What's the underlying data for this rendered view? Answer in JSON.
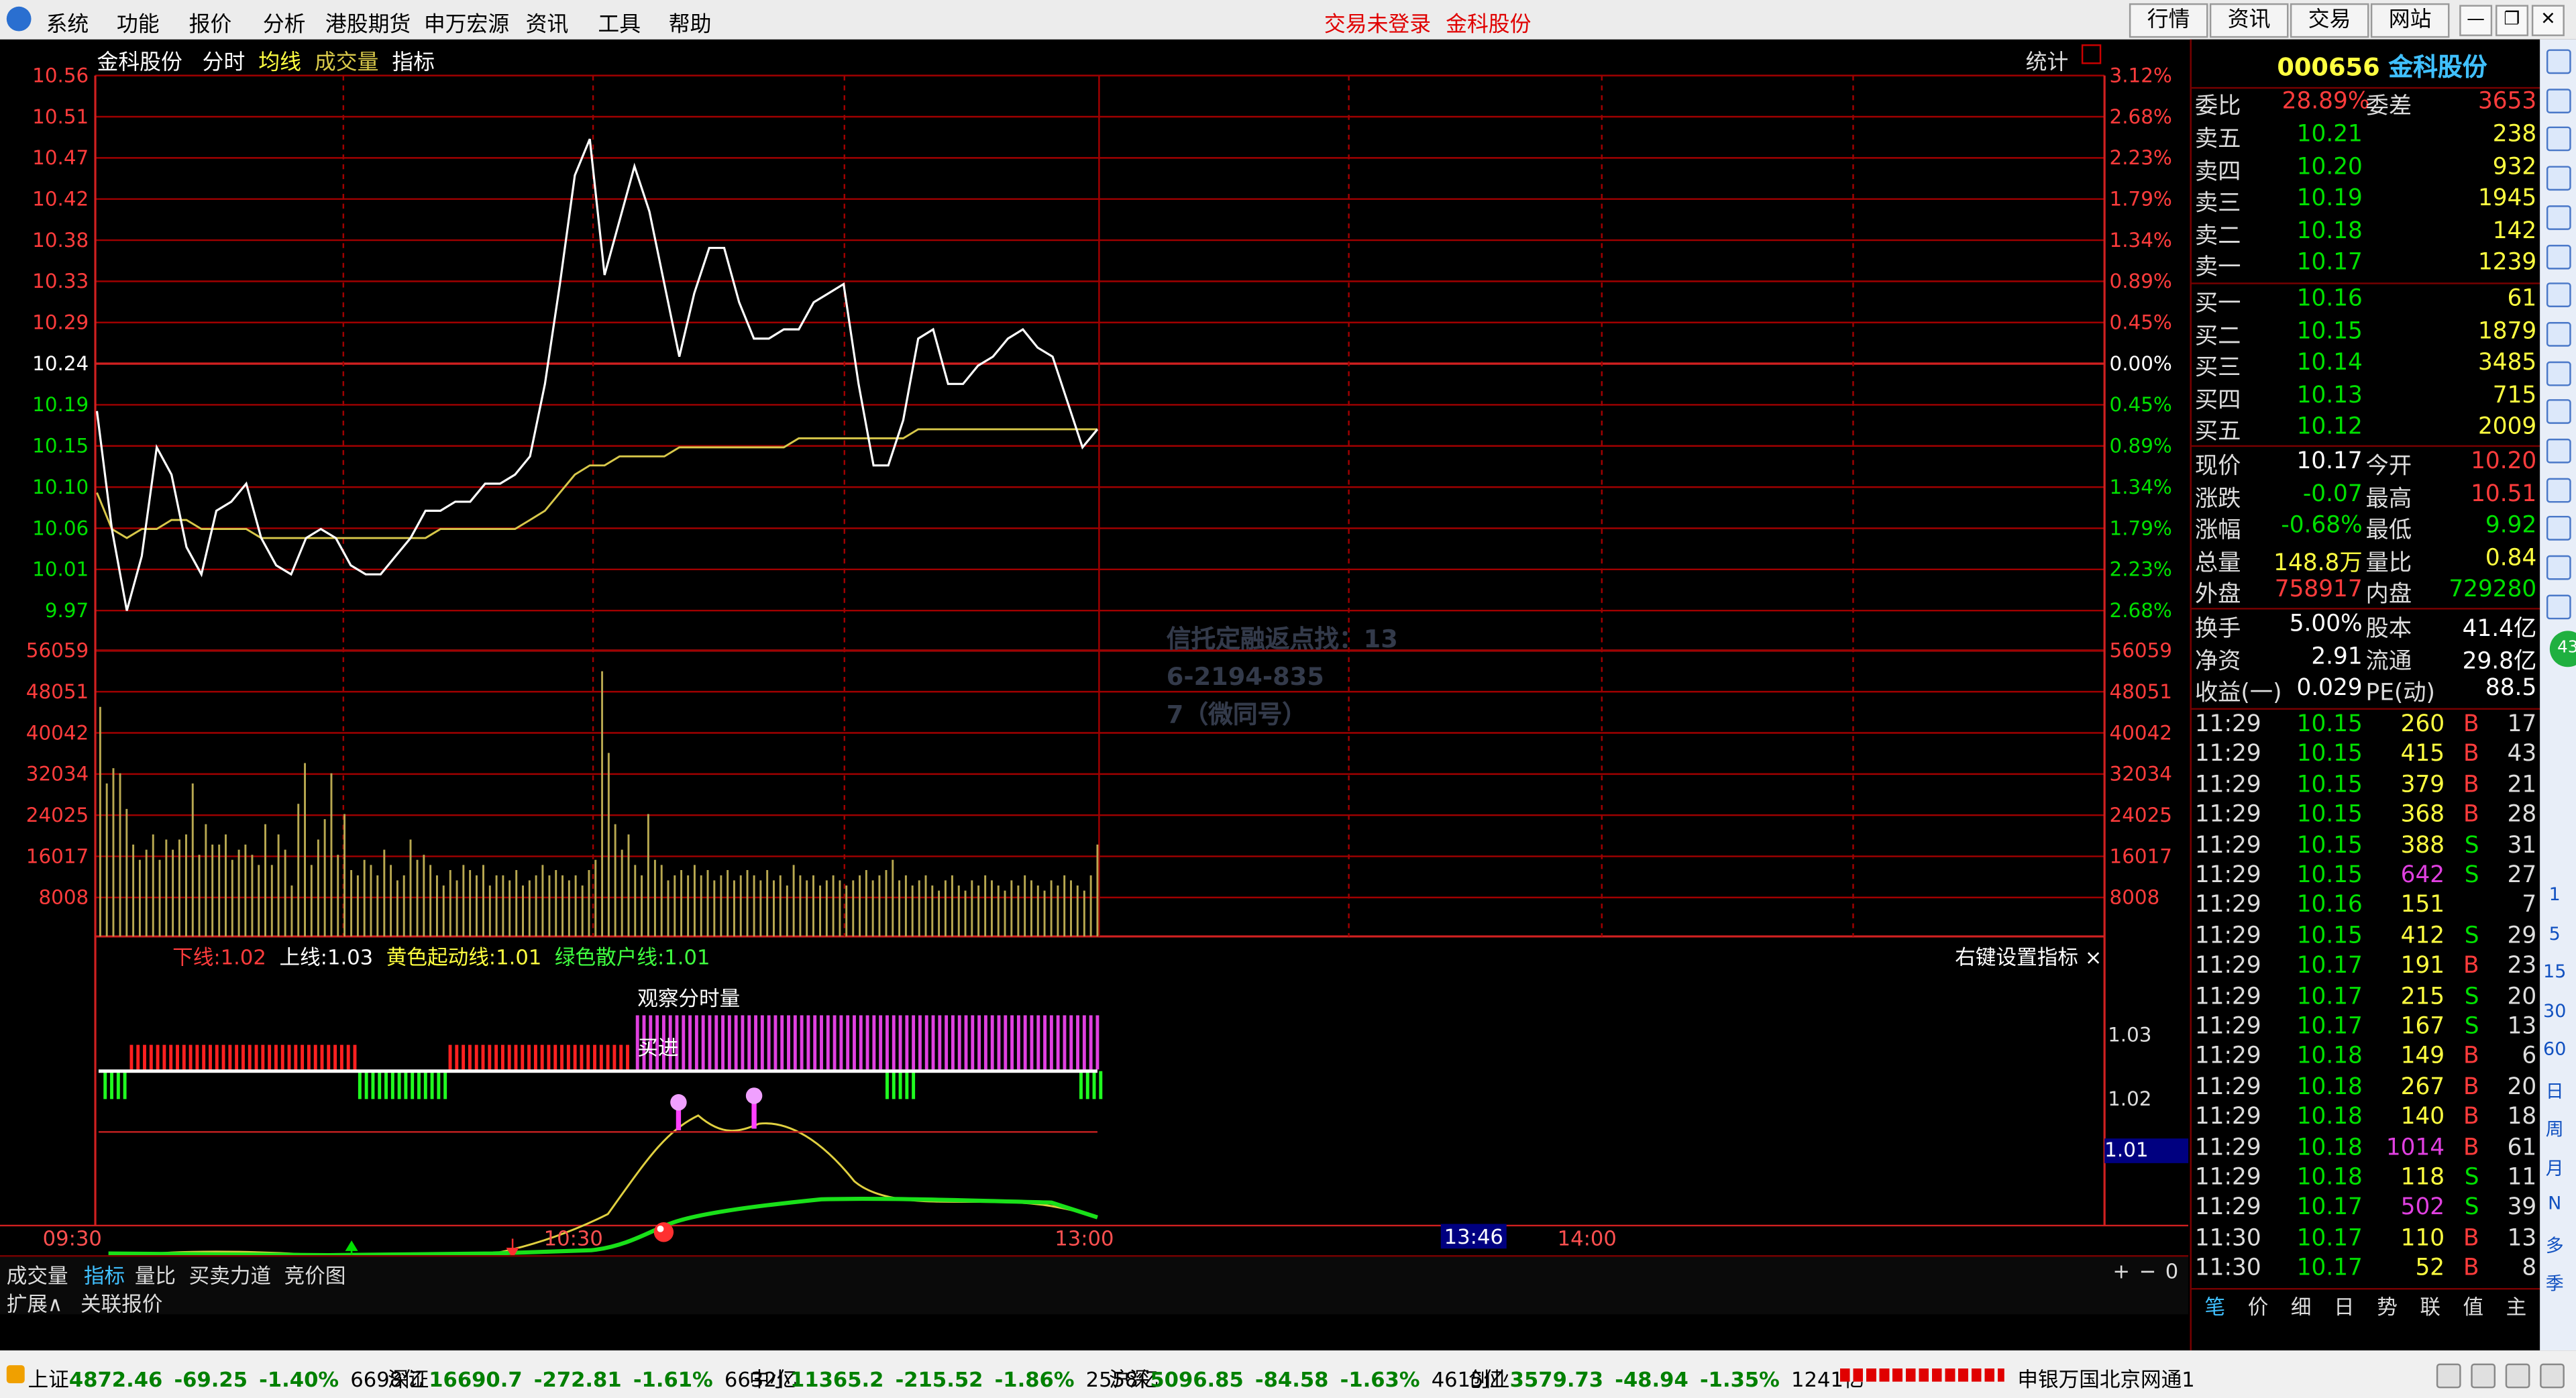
{
  "menu": {
    "items": [
      "系统",
      "功能",
      "报价",
      "分析",
      "港股期货",
      "申万宏源",
      "资讯",
      "工具",
      "帮助"
    ],
    "login_status": "交易未登录",
    "stock_name": "金科股份",
    "right_buttons": [
      "行情",
      "资讯",
      "交易",
      "网站"
    ]
  },
  "chart": {
    "stock": "金科股份",
    "tabs": [
      "分时",
      "均线",
      "成交量",
      "指标"
    ],
    "stats_label": "统计",
    "price_ticks": [
      "10.56",
      "10.51",
      "10.47",
      "10.42",
      "10.38",
      "10.33",
      "10.29",
      "10.24",
      "10.19",
      "10.15",
      "10.10",
      "10.06",
      "10.01",
      "9.97"
    ],
    "pct_ticks": [
      "3.12%",
      "2.68%",
      "2.23%",
      "1.79%",
      "1.34%",
      "0.89%",
      "0.45%",
      "0.00%",
      "0.45%",
      "0.89%",
      "1.34%",
      "1.79%",
      "2.23%",
      "2.68%"
    ],
    "vol_ticks": [
      "56059",
      "48051",
      "40042",
      "32034",
      "24025",
      "16017",
      "8008"
    ],
    "time_ticks": [
      "09:30",
      "10:30",
      "13:00",
      "14:00"
    ],
    "cursor_time": "13:46",
    "indicator": {
      "labels": [
        {
          "text": "下线:",
          "value": "1.02"
        },
        {
          "text": "上线:",
          "value": "1.03"
        },
        {
          "text": "黄色起动线:",
          "value": "1.01"
        },
        {
          "text": "绿色散户线:",
          "value": "1.01"
        }
      ],
      "settings_label": "右键设置指标 ×",
      "watch_label": "观察分时量",
      "buy_label": "买进",
      "ticks": [
        "1.03",
        "1.02",
        "1.01"
      ],
      "current_value": "1.01"
    },
    "watermark": [
      "信托定融返点找：13",
      "6-2194-835",
      "7（微同号）"
    ],
    "bottom_tabs": [
      "成交量",
      "指标",
      "量比",
      "买卖力道",
      "竞价图"
    ],
    "active_bottom_tab": "指标",
    "zoom_controls": [
      "+",
      "−",
      "0"
    ],
    "expand_tabs": [
      "扩展∧",
      "关联报价"
    ],
    "price_series": [
      10.19,
      10.06,
      9.97,
      10.03,
      10.15,
      10.12,
      10.04,
      10.01,
      10.08,
      10.09,
      10.11,
      10.05,
      10.02,
      10.01,
      10.05,
      10.06,
      10.05,
      10.02,
      10.01,
      10.01,
      10.03,
      10.05,
      10.08,
      10.08,
      10.09,
      10.09,
      10.11,
      10.11,
      10.12,
      10.14,
      10.22,
      10.33,
      10.45,
      10.49,
      10.34,
      10.4,
      10.46,
      10.41,
      10.33,
      10.25,
      10.32,
      10.37,
      10.37,
      10.31,
      10.27,
      10.27,
      10.28,
      10.28,
      10.31,
      10.32,
      10.33,
      10.22,
      10.13,
      10.13,
      10.18,
      10.27,
      10.28,
      10.22,
      10.22,
      10.24,
      10.25,
      10.27,
      10.28,
      10.26,
      10.25,
      10.2,
      10.15,
      10.17
    ],
    "avg_series": [
      10.1,
      10.06,
      10.05,
      10.06,
      10.06,
      10.07,
      10.07,
      10.06,
      10.06,
      10.06,
      10.06,
      10.05,
      10.05,
      10.05,
      10.05,
      10.05,
      10.05,
      10.05,
      10.05,
      10.05,
      10.05,
      10.05,
      10.05,
      10.06,
      10.06,
      10.06,
      10.06,
      10.06,
      10.06,
      10.07,
      10.08,
      10.1,
      10.12,
      10.13,
      10.13,
      10.14,
      10.14,
      10.14,
      10.14,
      10.15,
      10.15,
      10.15,
      10.15,
      10.15,
      10.15,
      10.15,
      10.15,
      10.16,
      10.16,
      10.16,
      10.16,
      10.16,
      10.16,
      10.16,
      10.16,
      10.17,
      10.17,
      10.17,
      10.17,
      10.17,
      10.17,
      10.17,
      10.17,
      10.17,
      10.17,
      10.17,
      10.17,
      10.17
    ],
    "volume_series": [
      45000,
      30000,
      33000,
      32000,
      25000,
      18000,
      15000,
      17000,
      20000,
      15000,
      19000,
      17000,
      19000,
      20000,
      30000,
      16000,
      22000,
      18000,
      18000,
      20000,
      15000,
      17000,
      18000,
      16000,
      14000,
      22000,
      14000,
      20000,
      17000,
      10000,
      26000,
      34000,
      14000,
      19000,
      23000,
      32000,
      16000,
      24000,
      13000,
      12000,
      15000,
      14000,
      12000,
      17000,
      14000,
      11000,
      12000,
      19000,
      15000,
      16000,
      14000,
      12000,
      10000,
      13000,
      11000,
      14000,
      13000,
      12000,
      14000,
      10000,
      12000,
      12000,
      11000,
      13000,
      10000,
      11000,
      12000,
      14000,
      12000,
      13000,
      12000,
      11000,
      12000,
      10000,
      13000,
      15000,
      52000,
      36000,
      22000,
      17000,
      20000,
      14000,
      12000,
      24000,
      15000,
      14000,
      11000,
      12000,
      13000,
      12000,
      14000,
      12000,
      13000,
      11000,
      12000,
      13000,
      11000,
      12000,
      13000,
      12000,
      11000,
      13000,
      11000,
      12000,
      10000,
      14000,
      12000,
      11000,
      12000,
      10000,
      11000,
      12000,
      11000,
      10000,
      11000,
      12000,
      13000,
      11000,
      12000,
      13000,
      15000,
      11000,
      12000,
      10000,
      11000,
      12000,
      10000,
      9000,
      11000,
      12000,
      10000,
      9000,
      11000,
      10000,
      12000,
      11000,
      10000,
      9000,
      11000,
      10000,
      12000,
      11000,
      10000,
      9000,
      11000,
      10000,
      12000,
      11000,
      10000,
      9000,
      12000,
      18000
    ]
  },
  "quote": {
    "code": "000656",
    "name": "金科股份",
    "weibi_label": "委比",
    "weibi": "28.89%",
    "weicha_label": "委差",
    "weicha": "3653",
    "asks": [
      {
        "label": "卖五",
        "price": "10.21",
        "vol": "238"
      },
      {
        "label": "卖四",
        "price": "10.20",
        "vol": "932"
      },
      {
        "label": "卖三",
        "price": "10.19",
        "vol": "1945"
      },
      {
        "label": "卖二",
        "price": "10.18",
        "vol": "142"
      },
      {
        "label": "卖一",
        "price": "10.17",
        "vol": "1239"
      }
    ],
    "bids": [
      {
        "label": "买一",
        "price": "10.16",
        "vol": "61"
      },
      {
        "label": "买二",
        "price": "10.15",
        "vol": "1879"
      },
      {
        "label": "买三",
        "price": "10.14",
        "vol": "3485"
      },
      {
        "label": "买四",
        "price": "10.13",
        "vol": "715"
      },
      {
        "label": "买五",
        "price": "10.12",
        "vol": "2009"
      }
    ],
    "stats": [
      {
        "l1": "现价",
        "v1": "10.17",
        "l2": "今开",
        "v2": "10.20"
      },
      {
        "l1": "涨跌",
        "v1": "-0.07",
        "l2": "最高",
        "v2": "10.51"
      },
      {
        "l1": "涨幅",
        "v1": "-0.68%",
        "l2": "最低",
        "v2": "9.92"
      },
      {
        "l1": "总量",
        "v1": "148.8万",
        "l2": "量比",
        "v2": "0.84"
      },
      {
        "l1": "外盘",
        "v1": "758917",
        "l2": "内盘",
        "v2": "729280"
      }
    ],
    "stats2": [
      {
        "l1": "换手",
        "v1": "5.00%",
        "l2": "股本",
        "v2": "41.4亿"
      },
      {
        "l1": "净资",
        "v1": "2.91",
        "l2": "流通",
        "v2": "29.8亿"
      },
      {
        "l1": "收益(一)",
        "v1": "0.029",
        "l2": "PE(动)",
        "v2": "88.5"
      }
    ],
    "ticks": [
      {
        "t": "11:29",
        "p": "10.15",
        "v": "260",
        "s": "B",
        "n": "17"
      },
      {
        "t": "11:29",
        "p": "10.15",
        "v": "415",
        "s": "B",
        "n": "43"
      },
      {
        "t": "11:29",
        "p": "10.15",
        "v": "379",
        "s": "B",
        "n": "21"
      },
      {
        "t": "11:29",
        "p": "10.15",
        "v": "368",
        "s": "B",
        "n": "28"
      },
      {
        "t": "11:29",
        "p": "10.15",
        "v": "388",
        "s": "S",
        "n": "31"
      },
      {
        "t": "11:29",
        "p": "10.15",
        "v": "642",
        "s": "S",
        "n": "27"
      },
      {
        "t": "11:29",
        "p": "10.16",
        "v": "151",
        "s": "",
        "n": "7"
      },
      {
        "t": "11:29",
        "p": "10.15",
        "v": "412",
        "s": "S",
        "n": "29"
      },
      {
        "t": "11:29",
        "p": "10.17",
        "v": "191",
        "s": "B",
        "n": "23"
      },
      {
        "t": "11:29",
        "p": "10.17",
        "v": "215",
        "s": "S",
        "n": "20"
      },
      {
        "t": "11:29",
        "p": "10.17",
        "v": "167",
        "s": "S",
        "n": "13"
      },
      {
        "t": "11:29",
        "p": "10.18",
        "v": "149",
        "s": "B",
        "n": "6"
      },
      {
        "t": "11:29",
        "p": "10.18",
        "v": "267",
        "s": "B",
        "n": "20"
      },
      {
        "t": "11:29",
        "p": "10.18",
        "v": "140",
        "s": "B",
        "n": "18"
      },
      {
        "t": "11:29",
        "p": "10.18",
        "v": "1014",
        "s": "B",
        "n": "61"
      },
      {
        "t": "11:29",
        "p": "10.18",
        "v": "118",
        "s": "S",
        "n": "11"
      },
      {
        "t": "11:29",
        "p": "10.17",
        "v": "502",
        "s": "S",
        "n": "39"
      },
      {
        "t": "11:30",
        "p": "10.17",
        "v": "110",
        "s": "B",
        "n": "13"
      },
      {
        "t": "11:30",
        "p": "10.17",
        "v": "52",
        "s": "B",
        "n": "8"
      }
    ],
    "tabs": [
      "笔",
      "价",
      "细",
      "日",
      "势",
      "联",
      "值",
      "主"
    ]
  },
  "sidebar": {
    "labels": [
      "1",
      "5",
      "15",
      "30",
      "60",
      "日",
      "周",
      "月",
      "N",
      "多",
      "季"
    ],
    "badge": "43"
  },
  "status": {
    "indices": [
      {
        "name": "上证",
        "value": "4872.46",
        "chg": "-69.25",
        "pct": "-1.40%",
        "amt": "6698亿"
      },
      {
        "name": "深证",
        "value": "16690.7",
        "chg": "-272.81",
        "pct": "-1.61%",
        "amt": "6632亿"
      },
      {
        "name": "中小",
        "value": "11365.2",
        "chg": "-215.52",
        "pct": "-1.86%",
        "amt": "2558亿"
      },
      {
        "name": "沪深",
        "value": "5096.85",
        "chg": "-84.58",
        "pct": "-1.63%",
        "amt": "4615亿"
      },
      {
        "name": "创业",
        "value": "3579.73",
        "chg": "-48.94",
        "pct": "-1.35%",
        "amt": "1241亿"
      }
    ],
    "server": "申银万国北京网通1"
  },
  "colors": {
    "up": "#ff3c3c",
    "down": "#00e000",
    "grid": "#a00000",
    "price_line": "#ffffff",
    "avg_line": "#d8c84a",
    "volume": "#b8a850",
    "magenta": "#e040e0"
  }
}
